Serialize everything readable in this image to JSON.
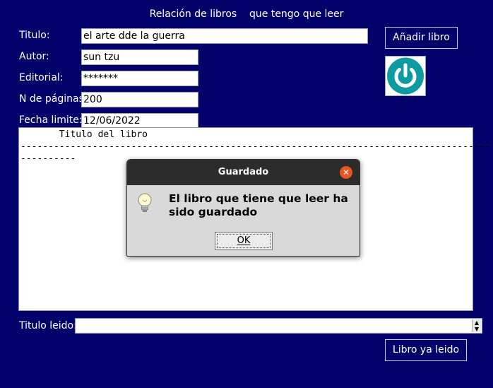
{
  "header": {
    "part1": "Relación de libros",
    "part2": "que tengo que leer"
  },
  "form": {
    "titulo_label": "Titulo:",
    "titulo_value": "el arte dde la guerra",
    "autor_label": "Autor:",
    "autor_value": "sun tzu",
    "editorial_label": "Editorial:",
    "editorial_value": "*******",
    "paginas_label": "N de páginas:",
    "paginas_value": "200",
    "fecha_label": "Fecha limite:",
    "fecha_value": "12/06/2022"
  },
  "buttons": {
    "add_label": "Añadir libro",
    "read_label": "Libro ya leido"
  },
  "list": {
    "header": "       Titulo del libro",
    "separator1": "-------------------------------------------------------------------------------------",
    "separator2": "----------"
  },
  "read_field": {
    "label": "Titulo leido:",
    "value": ""
  },
  "dialog": {
    "title": "Guardado",
    "message": "El libro que tiene que leer ha sido guardado",
    "ok_label": "OK"
  },
  "colors": {
    "background": "#03036b",
    "power_icon": "#0d9aa0",
    "close": "#e95420"
  },
  "icons": {
    "power": "power-icon",
    "bulb": "lightbulb-icon",
    "close": "close-icon"
  }
}
